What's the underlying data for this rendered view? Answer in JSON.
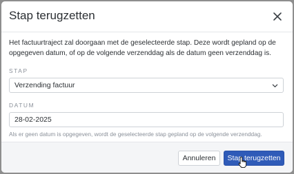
{
  "modal": {
    "title": "Stap terugzetten",
    "description": "Het factuurtraject zal doorgaan met de geselecteerde stap. Deze wordt gepland op de opgegeven datum, of op de volgende verzenddag als de datum geen verzenddag is.",
    "stap_label": "STAP",
    "stap_value": "Verzending factuur",
    "datum_label": "DATUM",
    "datum_value": "28-02-2025",
    "hint": "Als er geen datum is opgegeven, wordt de geselecteerde stap gepland op de volgende verzenddag.",
    "cancel_label": "Annuleren",
    "confirm_label": "Stap terugzetten"
  },
  "colors": {
    "primary": "#2f5bb8",
    "text": "#2b2f33",
    "muted": "#8a9099",
    "backdrop": "#8e8e8e"
  },
  "icons": {
    "close": "close-icon",
    "select": "chevron-down-icon",
    "cursor": "hand-pointer-icon"
  }
}
